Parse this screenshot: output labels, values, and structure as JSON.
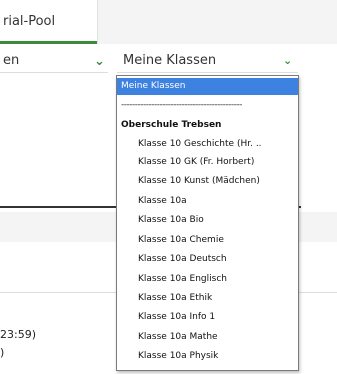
{
  "tabs": {
    "active_label": "rial-Pool"
  },
  "filters": {
    "left_value": "en",
    "right_value": "Meine Klassen"
  },
  "dropdown": {
    "selected": "Meine Klassen",
    "separator": "--------------------------------------------",
    "group": "Oberschule Trebsen",
    "options": [
      "Klasse 10 Geschichte (Hr. ..",
      "Klasse 10 GK (Fr. Horbert)",
      "Klasse 10 Kunst (Mädchen)",
      "Klasse 10a",
      "Klasse 10a Bio",
      "Klasse 10a Chemie",
      "Klasse 10a Deutsch",
      "Klasse 10a Englisch",
      "Klasse 10a Ethik",
      "Klasse 10a Info 1",
      "Klasse 10a Mathe",
      "Klasse 10a Physik"
    ]
  },
  "background_text": {
    "line1": "23:59)",
    "line2": ")"
  },
  "colors": {
    "accent": "#3c8a3b",
    "selection": "#3d82e0"
  }
}
